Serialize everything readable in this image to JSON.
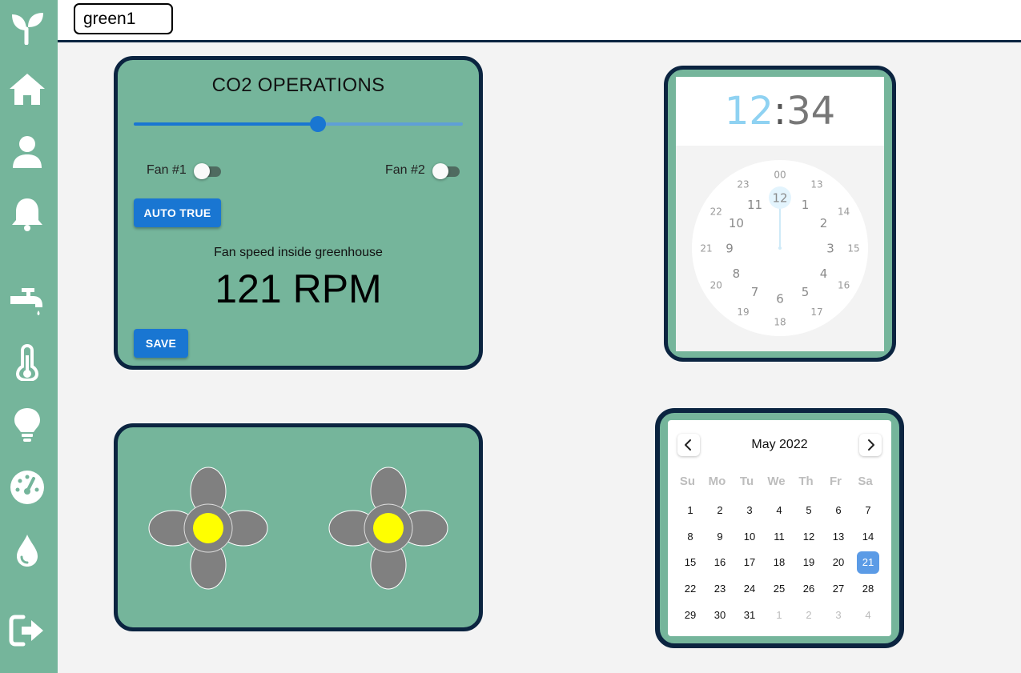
{
  "sidebar": {
    "items": [
      {
        "icon": "sprout-logo-icon"
      },
      {
        "icon": "home-icon"
      },
      {
        "icon": "user-icon"
      },
      {
        "icon": "bell-icon"
      },
      {
        "icon": "water-tap-icon"
      },
      {
        "icon": "thermometer-icon"
      },
      {
        "icon": "lightbulb-icon"
      },
      {
        "icon": "gauge-icon"
      },
      {
        "icon": "water-drop-icon"
      },
      {
        "icon": "logout-icon"
      }
    ]
  },
  "topbar": {
    "greenhouse_value": "green1"
  },
  "co2": {
    "title": "CO2 OPERATIONS",
    "slider_value": 0.56,
    "fan1_label": "Fan #1",
    "fan2_label": "Fan #2",
    "fan1_on": false,
    "fan2_on": false,
    "auto_button": "AUTO TRUE",
    "speed_caption": "Fan speed inside greenhouse",
    "speed_value": "121 RPM",
    "save_button": "SAVE"
  },
  "fans": [
    {
      "name": "fan-1",
      "blade_color": "#808080",
      "hub_color": "#ffff00"
    },
    {
      "name": "fan-2",
      "blade_color": "#808080",
      "hub_color": "#ffff00"
    }
  ],
  "clock": {
    "hour": "12",
    "separator": ":",
    "minute": "34",
    "outer_hours": [
      "12",
      "1",
      "2",
      "3",
      "4",
      "5",
      "6",
      "7",
      "8",
      "9",
      "10",
      "11"
    ],
    "inner_hours": [
      "00",
      "13",
      "14",
      "15",
      "16",
      "17",
      "18",
      "19",
      "20",
      "21",
      "22",
      "23"
    ],
    "selected_hour": "12"
  },
  "calendar": {
    "month_label": "May 2022",
    "weekdays": [
      "Su",
      "Mo",
      "Tu",
      "We",
      "Th",
      "Fr",
      "Sa"
    ],
    "weeks": [
      [
        {
          "d": "1"
        },
        {
          "d": "2"
        },
        {
          "d": "3"
        },
        {
          "d": "4"
        },
        {
          "d": "5"
        },
        {
          "d": "6"
        },
        {
          "d": "7"
        }
      ],
      [
        {
          "d": "8"
        },
        {
          "d": "9"
        },
        {
          "d": "10"
        },
        {
          "d": "11"
        },
        {
          "d": "12"
        },
        {
          "d": "13"
        },
        {
          "d": "14"
        }
      ],
      [
        {
          "d": "15"
        },
        {
          "d": "16"
        },
        {
          "d": "17"
        },
        {
          "d": "18"
        },
        {
          "d": "19"
        },
        {
          "d": "20"
        },
        {
          "d": "21",
          "selected": true
        }
      ],
      [
        {
          "d": "22"
        },
        {
          "d": "23"
        },
        {
          "d": "24"
        },
        {
          "d": "25"
        },
        {
          "d": "26"
        },
        {
          "d": "27"
        },
        {
          "d": "28"
        }
      ],
      [
        {
          "d": "29"
        },
        {
          "d": "30"
        },
        {
          "d": "31"
        },
        {
          "d": "1",
          "outside": true
        },
        {
          "d": "2",
          "outside": true
        },
        {
          "d": "3",
          "outside": true
        },
        {
          "d": "4",
          "outside": true
        }
      ]
    ]
  },
  "colors": {
    "sidebar": "#75b59b",
    "card": "#75b59b",
    "card_border": "#0b2440",
    "accent": "#1976d2",
    "selected_day": "#5b9be6"
  }
}
